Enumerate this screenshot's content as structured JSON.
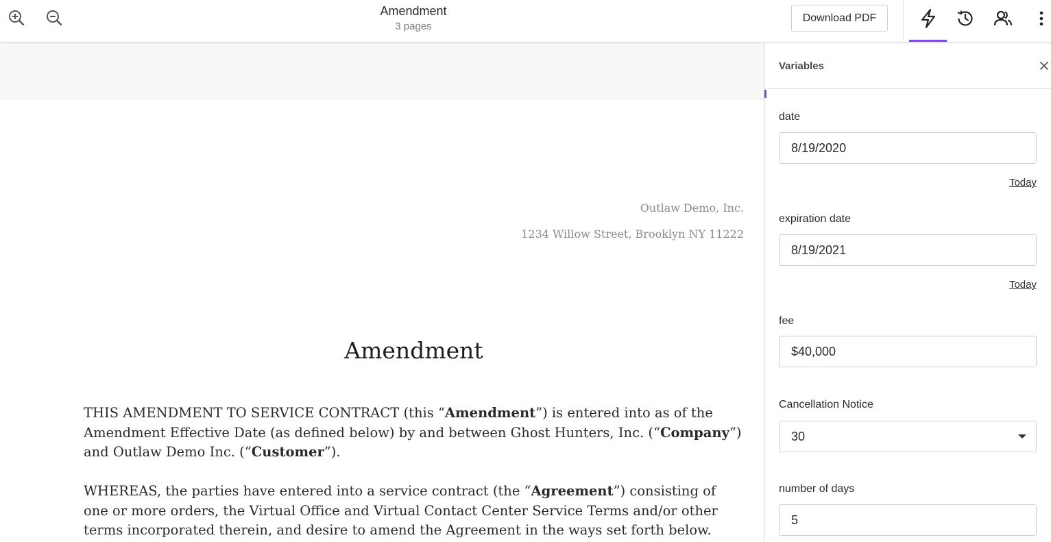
{
  "toolbar": {
    "zoom_in_icon": "zoom-in-icon",
    "zoom_out_icon": "zoom-out-icon",
    "title": "Amendment",
    "pages": "3 pages",
    "download_label": "Download PDF",
    "active_tab": "variables",
    "accent_color": "#7c4bd6",
    "icons": [
      "bolt-icon",
      "history-icon",
      "users-icon",
      "more-vertical-icon"
    ]
  },
  "document": {
    "company_name": "Outlaw Demo, Inc.",
    "company_address": "1234 Willow Street, Brooklyn NY 11222",
    "heading": "Amendment",
    "para1": {
      "t1": "THIS AMENDMENT TO SERVICE CONTRACT (this “",
      "b1": "Amendment",
      "t2": "”) is entered into as of the Amendment Effective Date (as defined below) by and between Ghost Hunters, Inc. (“",
      "b2": "Company",
      "t3": "”) and Outlaw Demo Inc. (“",
      "b3": "Customer",
      "t4": "”)."
    },
    "para2": {
      "t1": "WHEREAS, the parties have entered into a service contract (the “",
      "b1": "Agreement",
      "t2": "”) consisting of one or more orders, the Virtual Office and Virtual Contact Center Service Terms and/or other terms incorporated therein, and desire to amend the Agreement in the ways set forth below."
    }
  },
  "panel": {
    "title": "Variables",
    "fields": [
      {
        "label": "date",
        "value": "8/19/2020",
        "link": "Today"
      },
      {
        "label": "expiration date",
        "value": "8/19/2021",
        "link": "Today"
      },
      {
        "label": "fee",
        "value": "$40,000"
      },
      {
        "label": "Cancellation Notice",
        "value": "30",
        "type": "select"
      },
      {
        "label": "number of days",
        "value": "5"
      }
    ]
  }
}
